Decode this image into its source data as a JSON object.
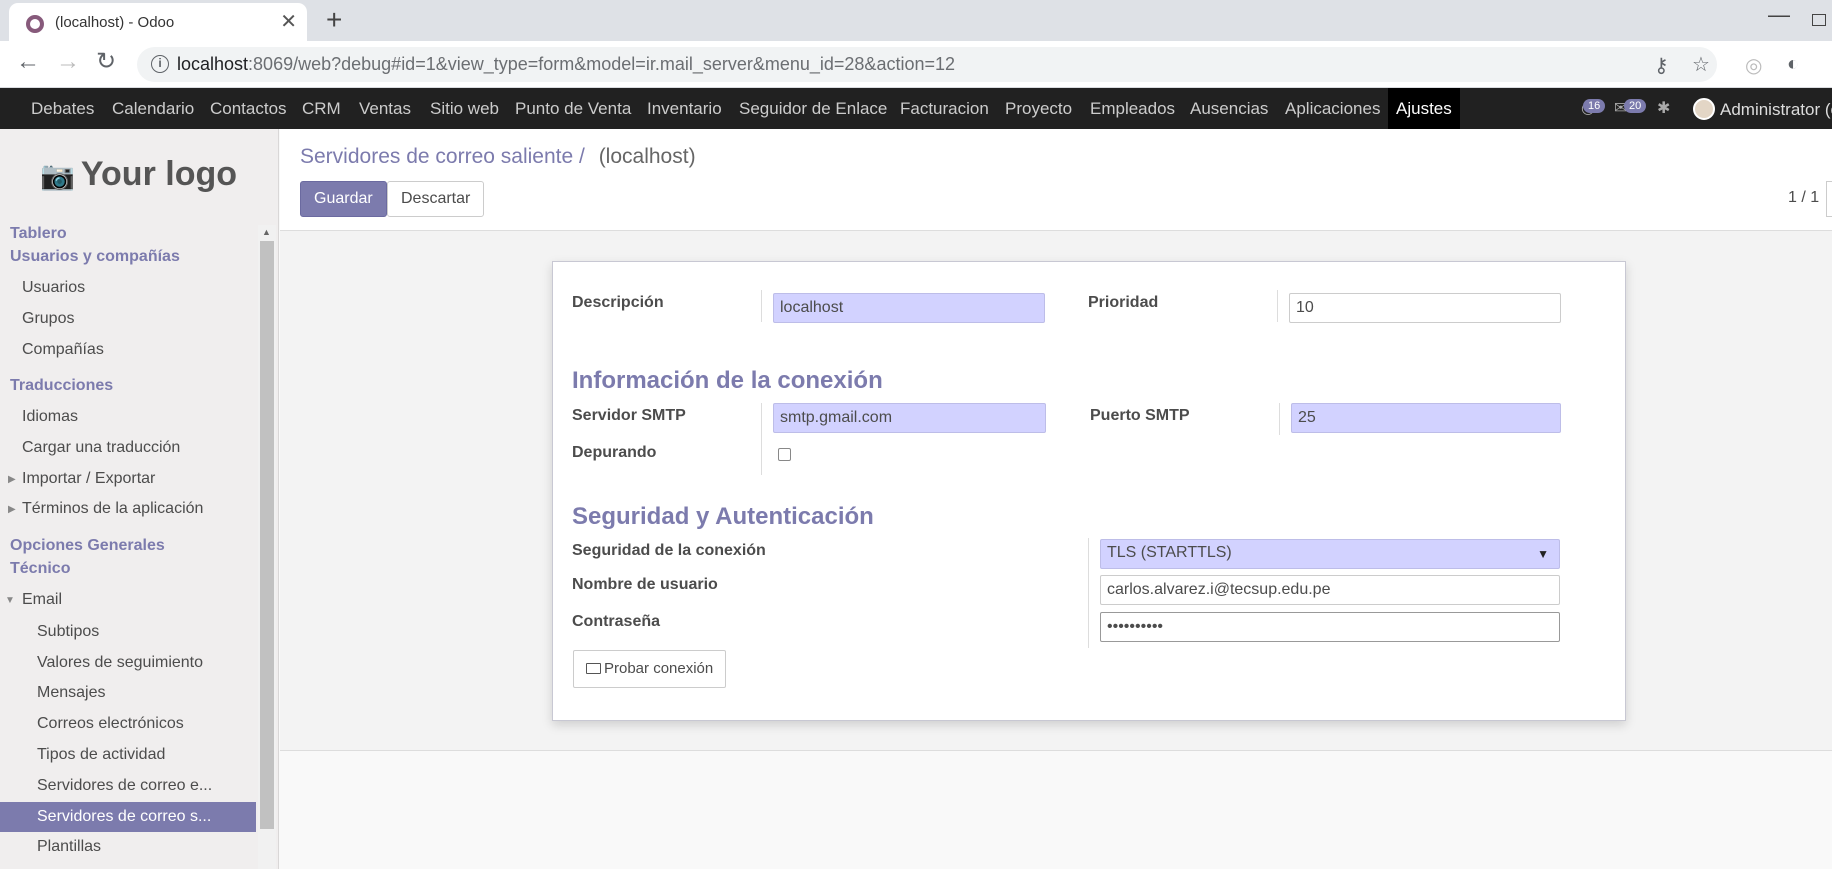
{
  "browser": {
    "tab_title": "(localhost) - Odoo",
    "tab_close": "✕",
    "new_tab": "+",
    "url_host": "localhost",
    "url_rest": ":8069/web?debug#id=1&view_type=form&model=ir.mail_server&menu_id=28&action=12"
  },
  "topmenu": {
    "items": [
      "Debates",
      "Calendario",
      "Contactos",
      "CRM",
      "Ventas",
      "Sitio web",
      "Punto de Venta",
      "Inventario",
      "Seguidor de Enlace",
      "Facturacion",
      "Proyecto",
      "Empleados",
      "Ausencias",
      "Aplicaciones",
      "Ajustes"
    ],
    "badge_activities": "16",
    "badge_messages": "20",
    "user": "Administrator (c"
  },
  "sidebar": {
    "logo_text": "Your logo",
    "items": [
      {
        "label": "Tablero"
      },
      {
        "label": "Usuarios y compañías"
      },
      {
        "label": "Usuarios"
      },
      {
        "label": "Grupos"
      },
      {
        "label": "Compañías"
      },
      {
        "label": "Traducciones"
      },
      {
        "label": "Idiomas"
      },
      {
        "label": "Cargar una traducción"
      },
      {
        "label": "Importar / Exportar"
      },
      {
        "label": "Términos de la aplicación"
      },
      {
        "label": "Opciones Generales"
      },
      {
        "label": "Técnico"
      },
      {
        "label": "Email"
      },
      {
        "label": "Subtipos"
      },
      {
        "label": "Valores de seguimiento"
      },
      {
        "label": "Mensajes"
      },
      {
        "label": "Correos electrónicos"
      },
      {
        "label": "Tipos de actividad"
      },
      {
        "label": "Servidores de correo e..."
      },
      {
        "label": "Servidores de correo s..."
      },
      {
        "label": "Plantillas"
      }
    ]
  },
  "control": {
    "breadcrumb_parent": "Servidores de correo saliente",
    "breadcrumb_sep": "/",
    "breadcrumb_current": "(localhost)",
    "save": "Guardar",
    "discard": "Descartar",
    "pager": "1 / 1"
  },
  "form": {
    "description_label": "Descripción",
    "description_value": "localhost",
    "priority_label": "Prioridad",
    "priority_value": "10",
    "section_connection": "Información de la conexión",
    "smtp_server_label": "Servidor SMTP",
    "smtp_server_value": "smtp.gmail.com",
    "smtp_port_label": "Puerto SMTP",
    "smtp_port_value": "25",
    "debug_label": "Depurando",
    "section_security": "Seguridad y Autenticación",
    "security_label": "Seguridad de la conexión",
    "security_value": "TLS (STARTTLS)",
    "username_label": "Nombre de usuario",
    "username_value": "carlos.alvarez.i@tecsup.edu.pe",
    "password_label": "Contraseña",
    "password_value": "••••••••••",
    "test_button": "Probar conexión"
  }
}
